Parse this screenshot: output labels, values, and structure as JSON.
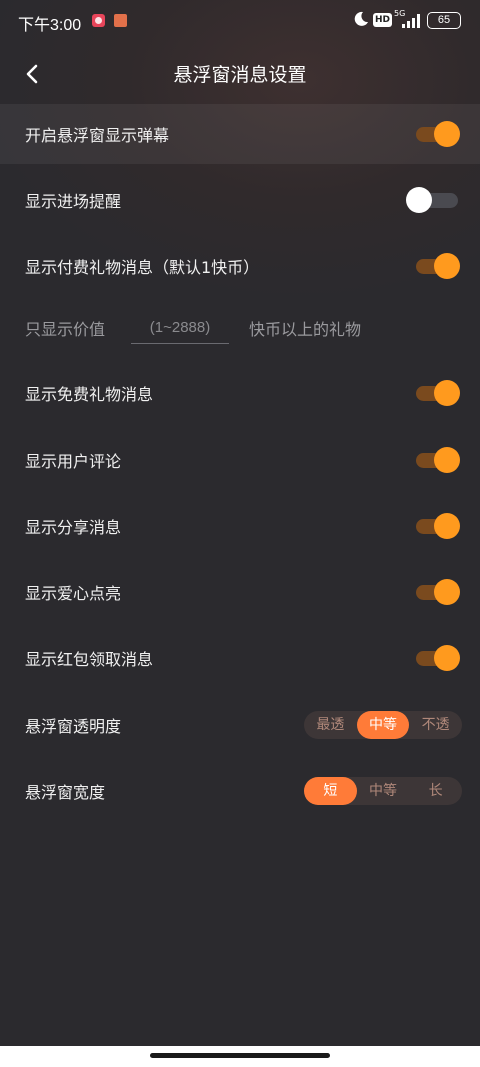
{
  "status_bar": {
    "time": "下午3:00",
    "network": "5G",
    "hd": "HD",
    "battery": "65"
  },
  "header": {
    "title": "悬浮窗消息设置",
    "back_icon": "chevron-left-icon"
  },
  "settings": {
    "row1_label": "开启悬浮窗显示弹幕",
    "row2_label": "显示进场提醒",
    "row3_label": "显示付费礼物消息（默认1快币）",
    "row4_prefix": "只显示价值",
    "row4_placeholder": "(1~2888)",
    "row4_suffix": "快币以上的礼物",
    "row5_label": "显示免费礼物消息",
    "row6_label": "显示用户评论",
    "row7_label": "显示分享消息",
    "row8_label": "显示爱心点亮",
    "row9_label": "显示红包领取消息",
    "transparency_label": "悬浮窗透明度",
    "width_label": "悬浮窗宽度"
  },
  "toggles": {
    "row1": true,
    "row2": false,
    "row3": true,
    "row5": true,
    "row6": true,
    "row7": true,
    "row8": true,
    "row9": true
  },
  "transparency_options": [
    "最透",
    "中等",
    "不透"
  ],
  "transparency_selected": "中等",
  "width_options": [
    "短",
    "中等",
    "长"
  ],
  "width_selected": "短",
  "colors": {
    "accent": "#ff9a1e",
    "segment_active": "#ff7b38",
    "background": "#2b2a2e"
  }
}
